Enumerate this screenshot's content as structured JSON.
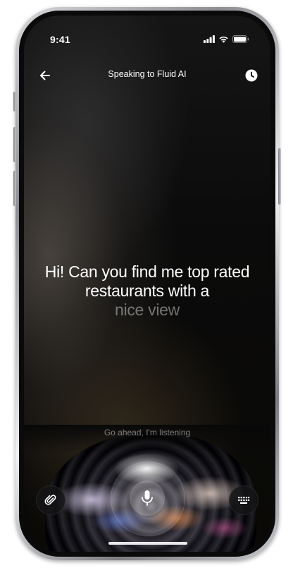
{
  "status_bar": {
    "time": "9:41"
  },
  "nav": {
    "title": "Speaking to Fluid AI",
    "back_icon": "arrow-left-icon",
    "history_icon": "clock-icon"
  },
  "transcript": {
    "spoken_text": "Hi! Can you find me top rated restaurants with a",
    "pending_text": "nice view"
  },
  "listening_hint": "Go ahead, I'm listening",
  "controls": {
    "attach_icon": "paperclip-icon",
    "mic_icon": "microphone-icon",
    "keyboard_icon": "keyboard-icon"
  },
  "colors": {
    "background": "#050505",
    "text": "#ffffff",
    "muted_text": "#8a8a8a"
  }
}
